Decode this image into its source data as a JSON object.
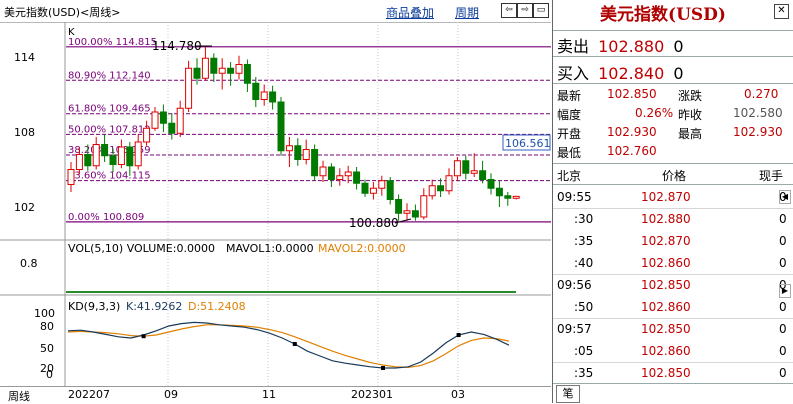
{
  "header": {
    "title": "美元指数(USD)<周线>",
    "overlay_btn": "商品叠加",
    "period_btn": "周期",
    "nav": [
      "⇦",
      "⇨",
      "▭"
    ]
  },
  "chart": {
    "y_main": [
      "114",
      "108",
      "102"
    ],
    "k_label": "K",
    "fib": [
      {
        "label": "100.00% 114.815",
        "v": 114.815
      },
      {
        "label": "80.90% 112.140",
        "v": 112.14
      },
      {
        "label": "61.80% 109.465",
        "v": 109.465
      },
      {
        "label": "50.00% 107.812",
        "v": 107.812
      },
      {
        "label": "38.20% 106.159",
        "v": 106.159
      },
      {
        "label": "23.60% 104.115",
        "v": 104.115
      },
      {
        "label": "0.00% 100.809",
        "v": 100.809
      }
    ],
    "high_label": "114.780",
    "low_label": "100.880",
    "price_tag": "106.561",
    "vol_label": "VOL(5,10) VOLUME:0.0000",
    "mavol1": "MAVOL1:0.0000",
    "mavol2": "MAVOL2:0.0000",
    "vol_y": "0.8",
    "kd_label": "KD(9,3,3)",
    "kd_k": "K:41.9262",
    "kd_d": "D:51.2408",
    "kd_y": [
      "100",
      "80",
      "50",
      "20",
      "0"
    ],
    "dates": [
      "周线",
      "202207",
      "09",
      "11",
      "202301",
      "03"
    ],
    "colors": {
      "up": "#e00000",
      "down": "#007a00",
      "fib": "#7a007a",
      "k": "#1a3a5a",
      "d": "#e08000"
    }
  },
  "quote": {
    "title": "美元指数(USD)",
    "sell_label": "卖出",
    "sell_price": "102.880",
    "sell_qty": "0",
    "buy_label": "买入",
    "buy_price": "102.840",
    "buy_qty": "0",
    "rows": [
      {
        "l1": "最新",
        "v1": "102.850",
        "l2": "涨跌",
        "v2": "0.270"
      },
      {
        "l1": "幅度",
        "v1": "0.26%",
        "l2": "昨收",
        "v2": "102.580"
      },
      {
        "l1": "开盘",
        "v1": "102.930",
        "l2": "最高",
        "v2": "102.930"
      },
      {
        "l1": "最低",
        "v1": "102.760",
        "l2": "",
        "v2": ""
      }
    ],
    "tick_headers": [
      "北京",
      "价格",
      "现手"
    ],
    "ticks": [
      {
        "t": "09:55",
        "p": "102.870",
        "q": "0"
      },
      {
        "t": ":30",
        "p": "102.880",
        "q": "0"
      },
      {
        "t": ":35",
        "p": "102.870",
        "q": "0"
      },
      {
        "t": ":40",
        "p": "102.860",
        "q": "0"
      },
      {
        "t": "09:56",
        "p": "102.850",
        "q": "0"
      },
      {
        "t": ":50",
        "p": "102.860",
        "q": "0"
      },
      {
        "t": "09:57",
        "p": "102.850",
        "q": "0"
      },
      {
        "t": ":05",
        "p": "102.860",
        "q": "0"
      },
      {
        "t": ":35",
        "p": "102.850",
        "q": "0"
      }
    ],
    "bottom_tab": "笔"
  }
}
